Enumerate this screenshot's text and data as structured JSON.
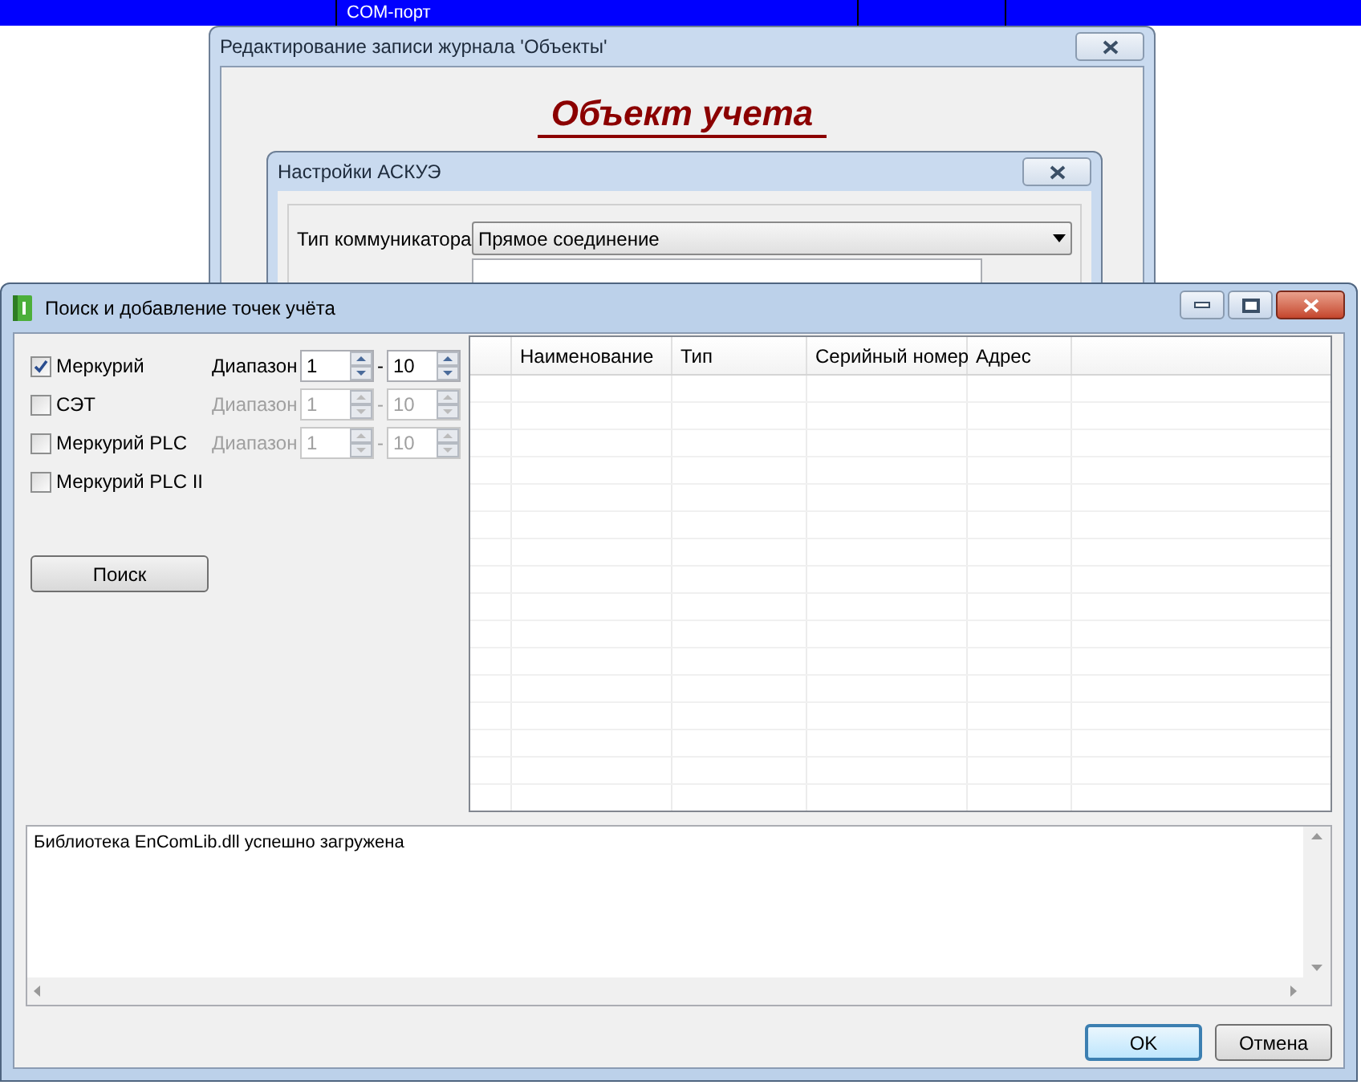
{
  "background_table": {
    "columns": [
      "COM-порт"
    ]
  },
  "back_dialog": {
    "title": "Редактирование записи журнала 'Объекты'",
    "heading": "Объект учета",
    "inner_dialog": {
      "title": "Настройки АСКУЭ",
      "fields": [
        {
          "label": "Тип коммуникатора",
          "value": "Прямое соединение"
        }
      ]
    }
  },
  "window": {
    "title": "Поиск и добавление точек учёта",
    "meters": [
      {
        "label": "Меркурий",
        "checked": true,
        "range": {
          "label": "Диапазон",
          "from": "1",
          "separator": "-",
          "to": "10",
          "disabled": false
        }
      },
      {
        "label": "СЭТ",
        "checked": false,
        "range": {
          "label": "Диапазон",
          "from": "1",
          "separator": "-",
          "to": "10",
          "disabled": true
        }
      },
      {
        "label": "Меркурий PLC",
        "checked": false,
        "range": {
          "label": "Диапазон",
          "from": "1",
          "separator": "-",
          "to": "10",
          "disabled": true
        }
      },
      {
        "label": "Меркурий PLC II",
        "checked": false
      }
    ],
    "search_button": "Поиск",
    "table": {
      "columns": [
        "Наименование",
        "Тип",
        "Серийный номер",
        "Адрес"
      ]
    },
    "log": [
      "Библиотека EnComLib.dll успешно загружена"
    ],
    "buttons": [
      {
        "label": "OK",
        "default": true
      },
      {
        "label": "Отмена",
        "default": false
      }
    ]
  }
}
